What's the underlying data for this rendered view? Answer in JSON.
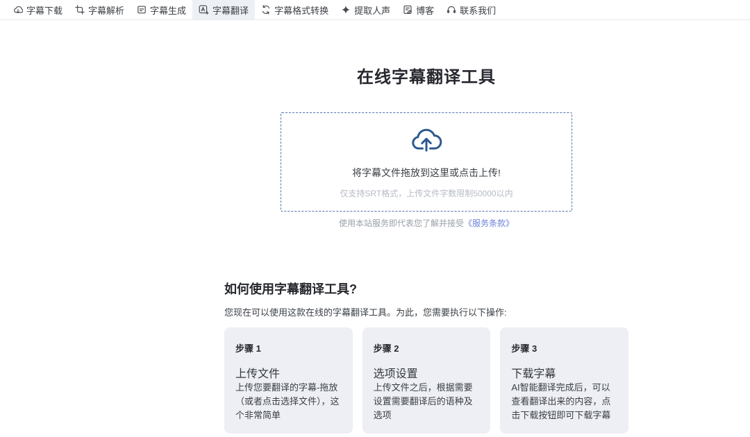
{
  "nav": {
    "items": [
      {
        "label": "字幕下载",
        "icon": "cloud-download-icon",
        "active": false
      },
      {
        "label": "字幕解析",
        "icon": "parse-icon",
        "active": false
      },
      {
        "label": "字幕生成",
        "icon": "generate-icon",
        "active": false
      },
      {
        "label": "字幕翻译",
        "icon": "translate-icon",
        "active": true
      },
      {
        "label": "字幕格式转换",
        "icon": "convert-icon",
        "active": false
      },
      {
        "label": "提取人声",
        "icon": "sparkle-icon",
        "active": false
      },
      {
        "label": "博客",
        "icon": "blog-icon",
        "active": false
      },
      {
        "label": "联系我们",
        "icon": "headset-icon",
        "active": false
      }
    ]
  },
  "hero": {
    "title": "在线字幕翻译工具",
    "upload": {
      "main_text": "将字幕文件拖放到这里或点击上传!",
      "hint_text": "仅支持SRT格式，上传文件字数限制50000以内"
    },
    "terms": {
      "prefix": "使用本站服务即代表您了解并接受",
      "link_text": "《服务条款》"
    }
  },
  "howto": {
    "heading": "如何使用字幕翻译工具?",
    "description": "您现在可以使用这款在线的字幕翻译工具。为此，您需要执行以下操作:",
    "steps": [
      {
        "step": "步骤 1",
        "title": "上传文件",
        "body": "上传您要翻译的字幕-拖放（或者点击选择文件），这个非常简单"
      },
      {
        "step": "步骤 2",
        "title": "选项设置",
        "body": "上传文件之后，根据需要设置需要翻译后的语种及选项"
      },
      {
        "step": "步骤 3",
        "title": "下载字幕",
        "body": "AI智能翻译完成后，可以查看翻译出来的内容，点击下载按钮即可下载字幕"
      }
    ]
  },
  "colors": {
    "upload_icon_blue": "#2d5a8e",
    "dashed_border_blue": "#5272ab",
    "link_blue": "#6f82d9",
    "active_nav_bg": "#edf0f5",
    "card_bg": "#edeff4"
  }
}
